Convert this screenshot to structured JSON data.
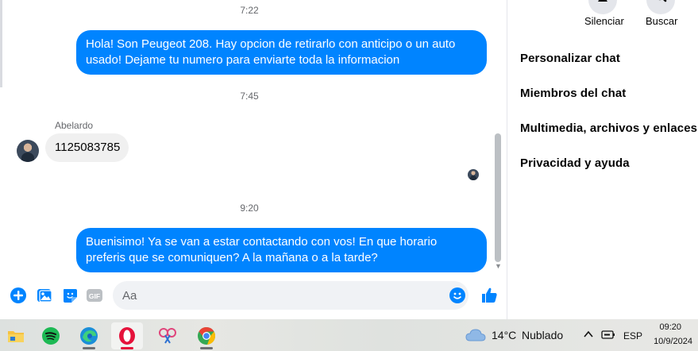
{
  "chat": {
    "messages": [
      {
        "time": "7:22"
      },
      {
        "text": "Hola! Son Peugeot 208. Hay opcion de retirarlo con anticipo o un auto usado! Dejame tu numero para enviarte toda la informacion"
      },
      {
        "time": "7:45"
      },
      {
        "sender": "Abelardo",
        "text": "1125083785"
      },
      {
        "time": "9:20"
      },
      {
        "text": "Buenisimo! Ya se van a estar contactando con vos! En que horario preferis que se comuniquen? A la mañana o a la tarde?"
      }
    ],
    "composer": {
      "placeholder": "Aa"
    }
  },
  "side": {
    "actions": [
      {
        "label": "Silenciar",
        "icon": "bell-icon"
      },
      {
        "label": "Buscar",
        "icon": "search-icon"
      }
    ],
    "menu": [
      "Personalizar chat",
      "Miembros del chat",
      "Multimedia, archivos y enlaces",
      "Privacidad y ayuda"
    ]
  },
  "taskbar": {
    "apps": [
      "file-explorer-icon",
      "spotify-icon",
      "edge-icon",
      "opera-icon",
      "snipping-tool-icon",
      "chrome-icon"
    ],
    "weather": {
      "temp": "14°C",
      "condition": "Nublado"
    },
    "lang": "ESP",
    "time": "09:20",
    "date": "10/9/2024"
  },
  "colors": {
    "accent": "#0084ff",
    "bubble_in": "#f0f0f0"
  }
}
